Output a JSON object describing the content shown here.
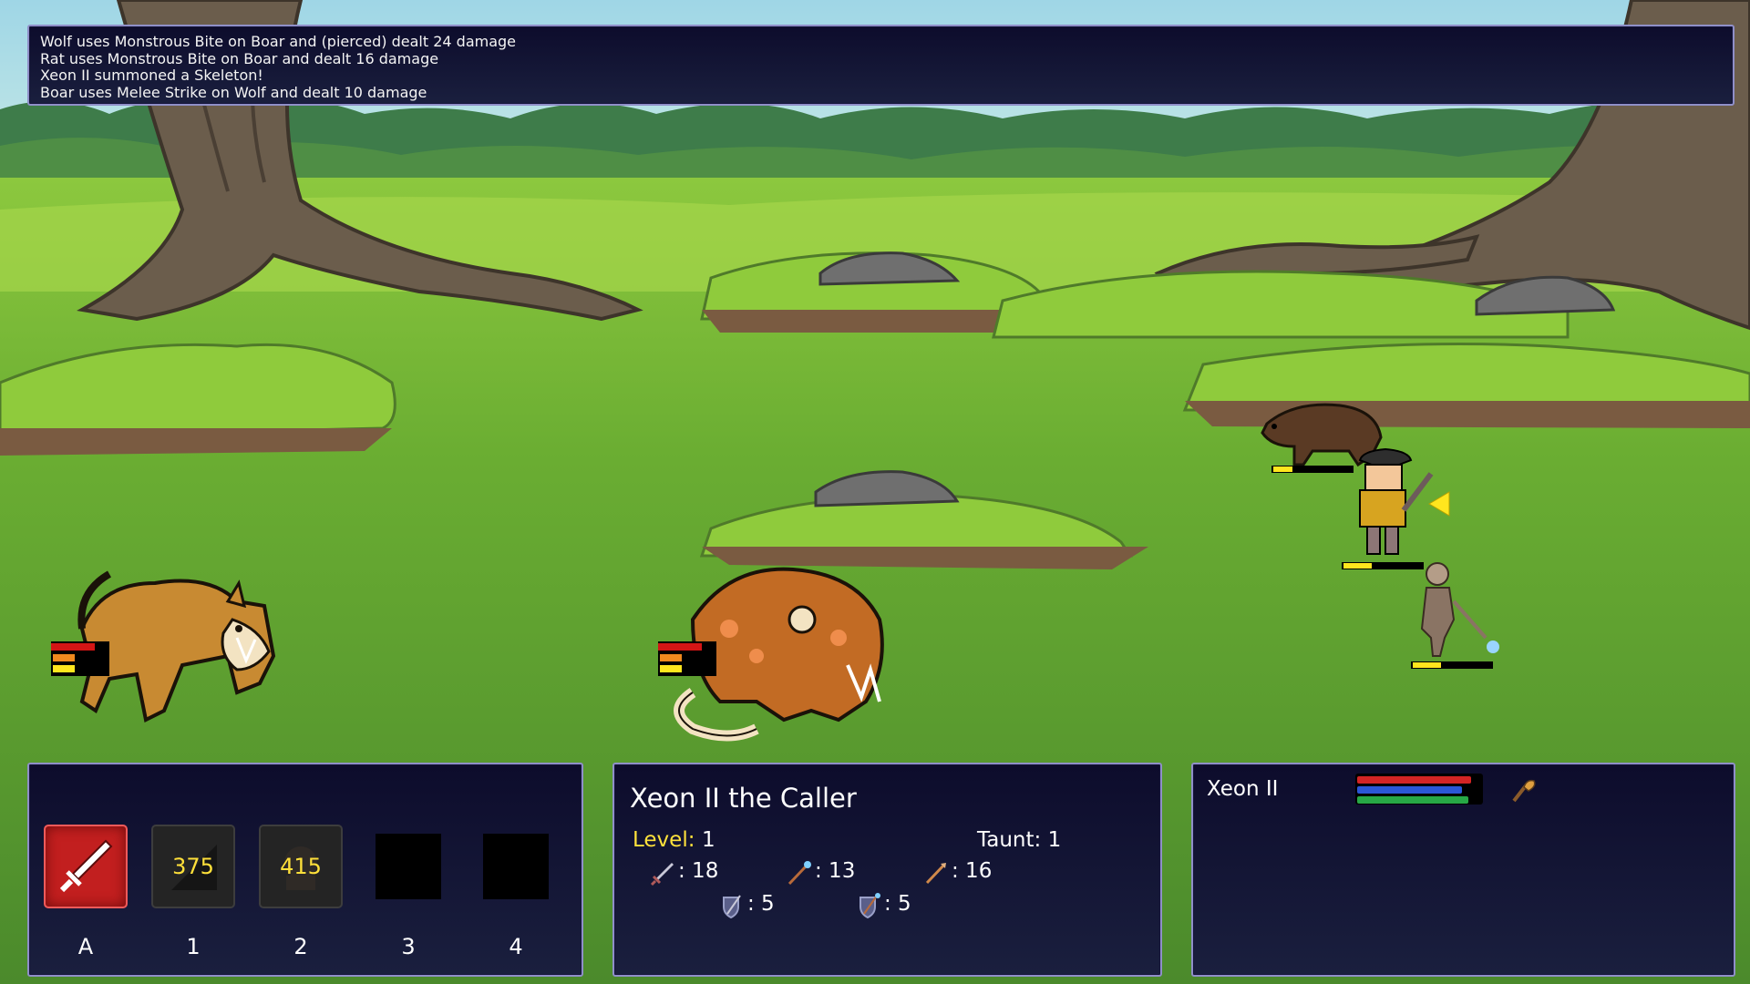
{
  "combat_log": {
    "lines": [
      "Wolf uses Monstrous Bite on Boar and (pierced) dealt 24 damage",
      "Rat uses Monstrous Bite on Boar and dealt 16 damage",
      "Xeon II summoned a Skeleton!",
      "Boar uses Melee Strike on Wolf and dealt 10 damage"
    ]
  },
  "battlefield": {
    "enemies": [
      {
        "name": "wolf",
        "hp_fraction": 0.6
      },
      {
        "name": "rat",
        "hp_fraction": 0.6
      }
    ],
    "allies": [
      {
        "name": "boar",
        "hp_fraction": 0.4
      },
      {
        "name": "xeon-ii",
        "hp_fraction": 0.6
      },
      {
        "name": "skeleton",
        "hp_fraction": 0.6
      }
    ]
  },
  "skills": {
    "slots": [
      {
        "key": "A",
        "icon": "sword-icon",
        "cooldown": ""
      },
      {
        "key": "1",
        "icon": "claw-icon",
        "cooldown": "375"
      },
      {
        "key": "2",
        "icon": "summon-icon",
        "cooldown": "415"
      },
      {
        "key": "3",
        "icon": "",
        "cooldown": ""
      },
      {
        "key": "4",
        "icon": "",
        "cooldown": ""
      }
    ]
  },
  "stats": {
    "title": "Xeon II the Caller",
    "level_label": "Level:",
    "level_value": "1",
    "taunt": "Taunt: 1",
    "melee": ": 18",
    "magic": ": 13",
    "ranged": ": 16",
    "phys_def": ": 5",
    "magic_def": ": 5"
  },
  "party": {
    "name": "Xeon II",
    "health": 0.98,
    "mana": 0.9,
    "stamina": 0.95,
    "weapon_icon": "club-icon"
  },
  "colors": {
    "panel_bg": "#0d0c2c",
    "panel_border": "#8f8fc8",
    "health": "#d42424",
    "mana": "#2b56d6",
    "stamina": "#27a846",
    "cooldown_text": "#ffe03a",
    "ally_hp": "#ffe61e",
    "enemy_hp": "#d41515"
  }
}
